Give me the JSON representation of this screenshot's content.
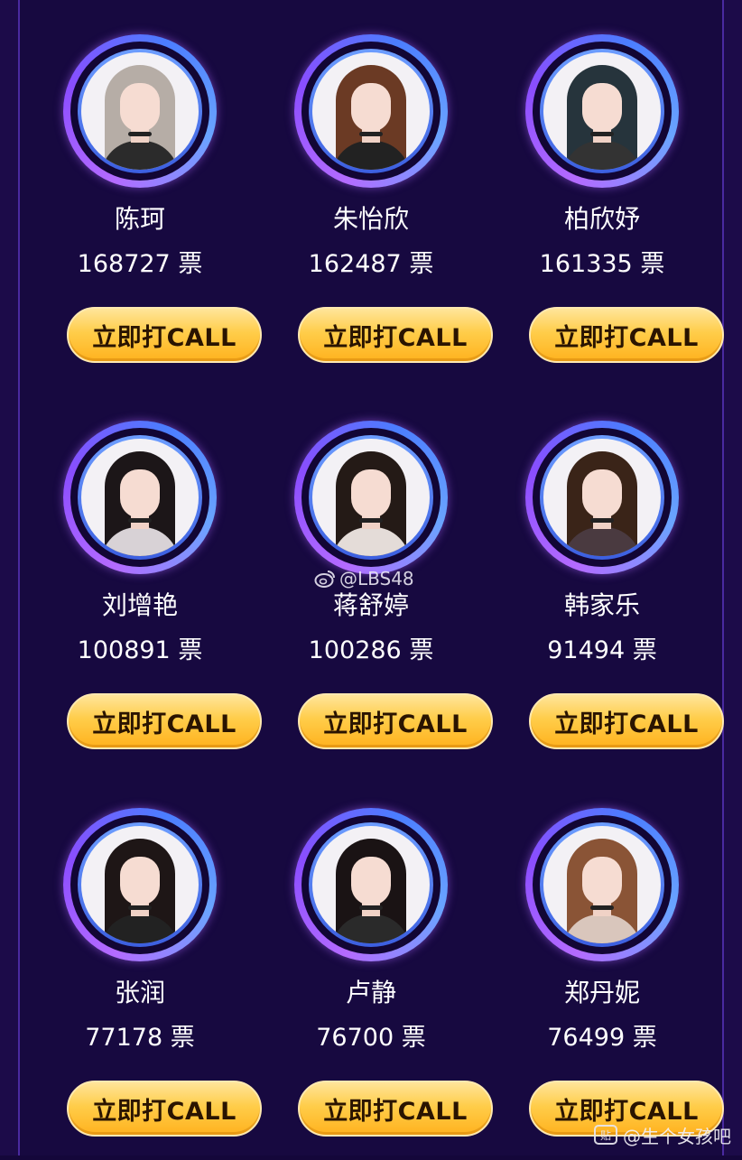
{
  "call_label": "立即打CALL",
  "vote_unit": "票",
  "candidates": [
    {
      "name": "陈珂",
      "votes": "168727",
      "hair": "#b6ada6",
      "top": "#2b2b2b"
    },
    {
      "name": "朱怡欣",
      "votes": "162487",
      "hair": "#6b3a24",
      "top": "#222222"
    },
    {
      "name": "柏欣妤",
      "votes": "161335",
      "hair": "#26343c",
      "top": "#333333"
    },
    {
      "name": "刘增艳",
      "votes": "100891",
      "hair": "#1c1618",
      "top": "#d8d2d6"
    },
    {
      "name": "蒋舒婷",
      "votes": "100286",
      "hair": "#241a16",
      "top": "#e4dcd8"
    },
    {
      "name": "韩家乐",
      "votes": "91494",
      "hair": "#3a2418",
      "top": "#4a3a40"
    },
    {
      "name": "张润",
      "votes": "77178",
      "hair": "#1e1616",
      "top": "#222222"
    },
    {
      "name": "卢静",
      "votes": "76700",
      "hair": "#1a1314",
      "top": "#2a2a2a"
    },
    {
      "name": "郑丹妮",
      "votes": "76499",
      "hair": "#8a5436",
      "top": "#d9c6bc"
    }
  ],
  "watermark_center": "@LBS48",
  "watermark_corner": "@生个女孩吧",
  "colors": {
    "background": "#170940",
    "button": "#ffc640",
    "ring": "#9a5cff"
  }
}
